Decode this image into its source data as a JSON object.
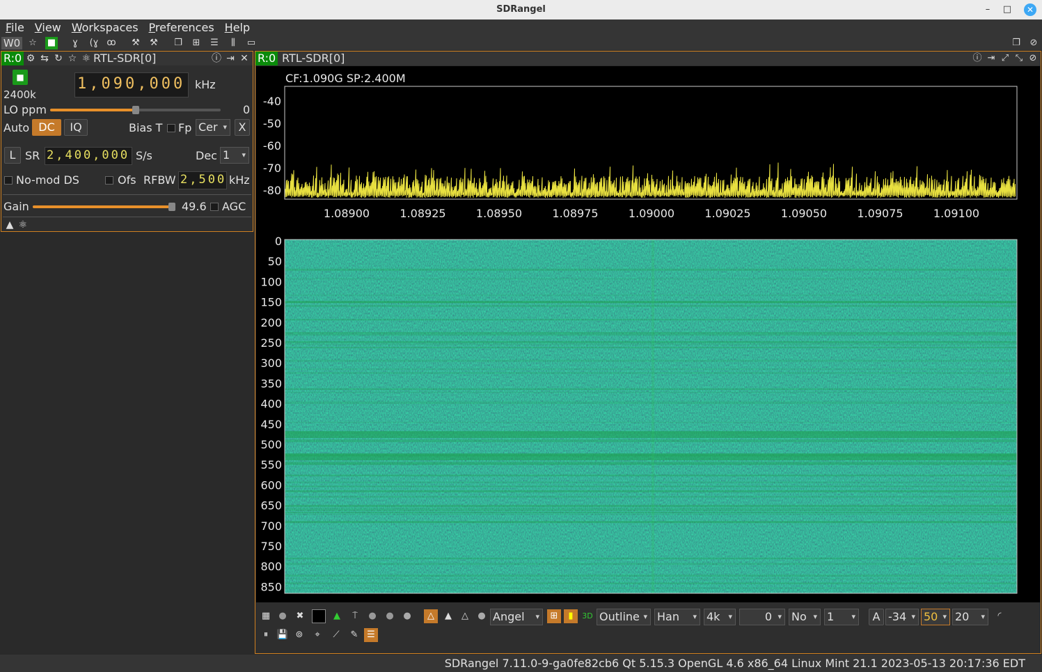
{
  "app": {
    "title": "SDRangel"
  },
  "menu": [
    "File",
    "View",
    "Workspaces",
    "Preferences",
    "Help"
  ],
  "toolbar": {
    "workspace_label": "W0"
  },
  "device": {
    "tag": "R:0",
    "name": "RTL-SDR[0]",
    "bandwidth": "2400k",
    "frequency": "1,090,000",
    "freq_unit": "kHz",
    "lo_label": "LO ppm",
    "lo_value": "0",
    "lo_level": 0.5,
    "auto_label": "Auto",
    "dc_label": "DC",
    "iq_label": "IQ",
    "biast_label": "Bias T",
    "fp_label": "Fp",
    "fp_value": "Cer",
    "x_label": "X",
    "l_label": "L",
    "sr_label": "SR",
    "sr_value": "2,400,000",
    "sr_unit": "S/s",
    "dec_label": "Dec",
    "dec_value": "1",
    "nomod_label": "No-mod DS",
    "ofs_label": "Ofs",
    "rfbw_label": "RFBW",
    "rfbw_value": "2,500",
    "rfbw_unit": "kHz",
    "gain_label": "Gain",
    "gain_value": "49.6",
    "gain_level": 1.0,
    "agc_label": "AGC"
  },
  "spectrum": {
    "tag": "R:0",
    "name": "RTL-SDR[0]",
    "info": "CF:1.090G SP:2.400M",
    "y_ticks": [
      "-40",
      "-50",
      "-60",
      "-70",
      "-80"
    ],
    "x_ticks": [
      "1.08900",
      "1.08925",
      "1.08950",
      "1.08975",
      "1.09000",
      "1.09025",
      "1.09050",
      "1.09075",
      "1.09100"
    ],
    "wf_ticks": [
      "0",
      "50",
      "100",
      "150",
      "200",
      "250",
      "300",
      "350",
      "400",
      "450",
      "500",
      "550",
      "600",
      "650",
      "700",
      "750",
      "800",
      "850"
    ],
    "colors": {
      "trace": "#e8e040",
      "waterfall_bg": "#0b2a3e",
      "waterfall_line": "#1ea050"
    }
  },
  "controls": {
    "colormap": "Angel",
    "trace_mode": "Outline",
    "window": "Han",
    "fft_size": "4k",
    "overlap": "0",
    "averaging": "No",
    "avg_count": "1",
    "auto_label": "A",
    "ref_level": "-34",
    "range": "50",
    "rate": "20"
  },
  "status": {
    "text": "SDRangel 7.11.0-9-ga0fe82cb6 Qt 5.15.3 OpenGL 4.6 x86_64 Linux Mint 21.1 2023-05-13 20:17:36 EDT"
  }
}
